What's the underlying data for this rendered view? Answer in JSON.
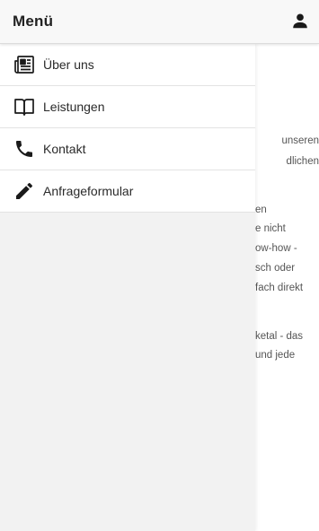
{
  "header": {
    "title": "Menü",
    "user_icon": "person-icon"
  },
  "menu": {
    "items": [
      {
        "label": "Über uns",
        "icon": "newspaper-icon"
      },
      {
        "label": "Leistungen",
        "icon": "book-icon"
      },
      {
        "label": "Kontakt",
        "icon": "phone-icon"
      },
      {
        "label": "Anfrageformular",
        "icon": "pencil-icon"
      }
    ]
  },
  "background_text": {
    "lines": [
      "unseren",
      "dlichen",
      "en",
      "e nicht",
      "ow-how -",
      "sch oder",
      "fach direkt",
      "ketal - das",
      "und jede"
    ]
  },
  "colors": {
    "header_bg": "#f8f8f8",
    "drawer_bg": "#f2f2f2",
    "item_bg": "#ffffff",
    "text": "#2a2a2a"
  }
}
